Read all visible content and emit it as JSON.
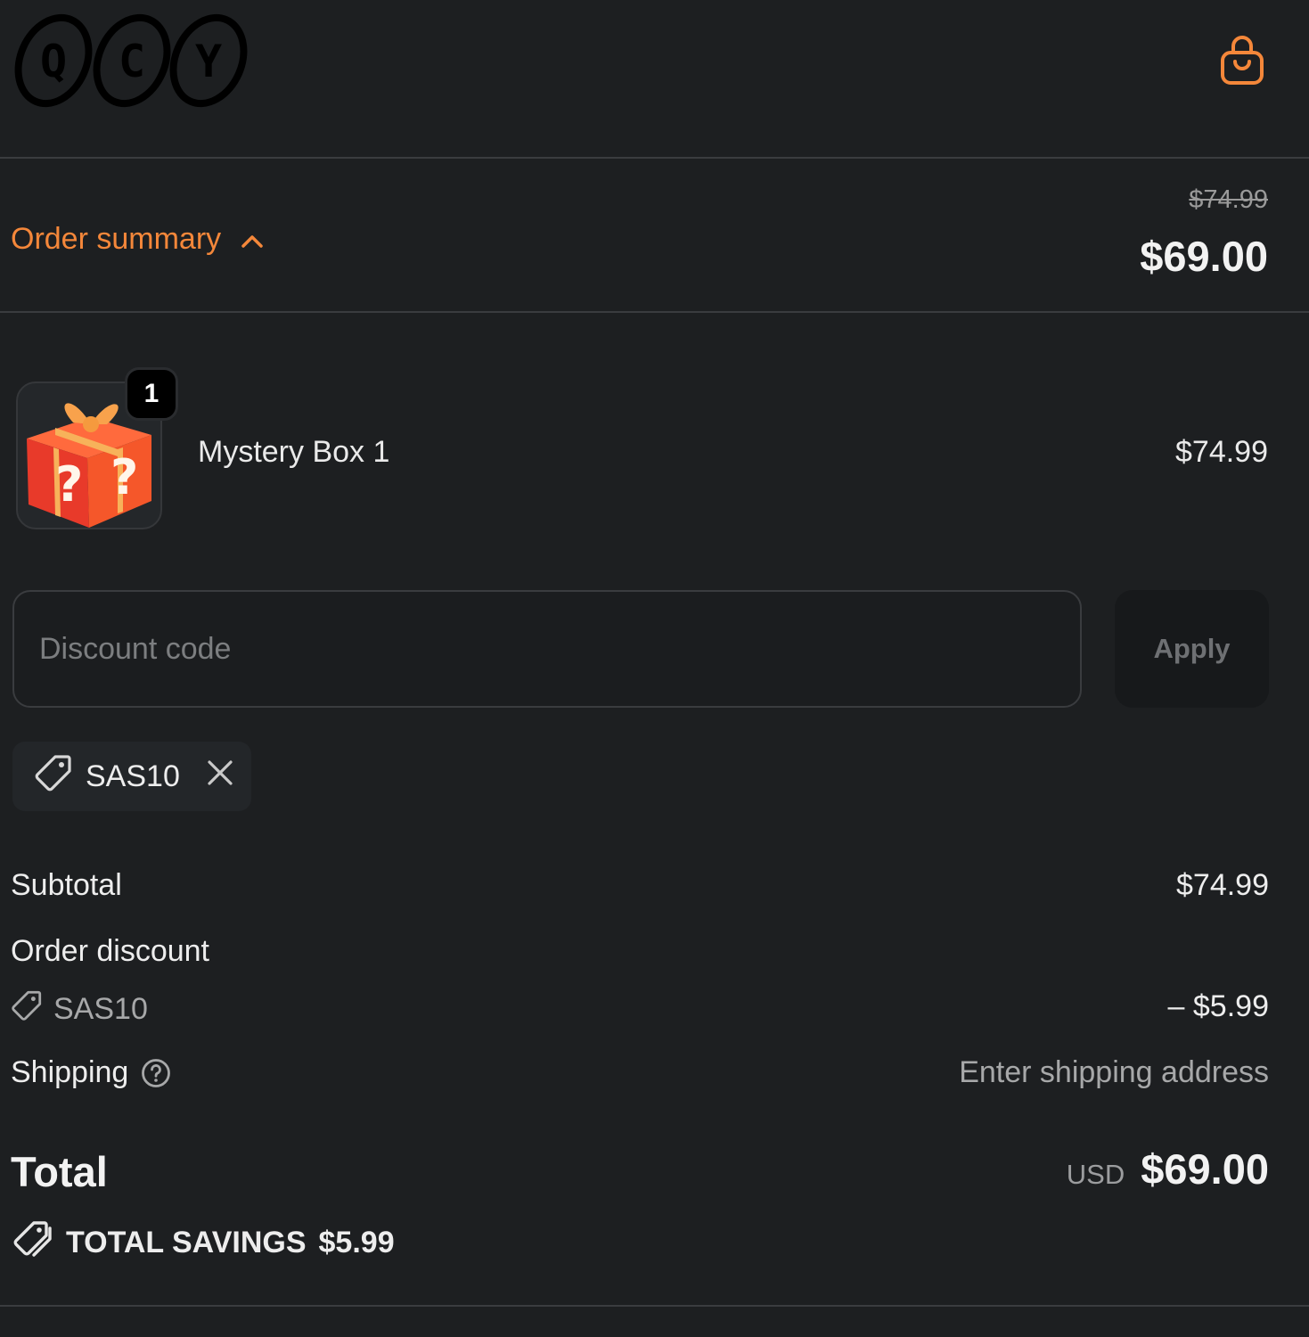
{
  "header": {
    "logo_letters": [
      "Q",
      "C",
      "Y"
    ],
    "cart_icon": "shopping-bag-icon"
  },
  "summary": {
    "toggle_label": "Order summary",
    "toggle_icon": "chevron-up-icon",
    "original_price": "$74.99",
    "discounted_price": "$69.00"
  },
  "product": {
    "name": "Mystery Box 1",
    "price": "$74.99",
    "quantity": "1",
    "image_icon": "mystery-gift-box-image"
  },
  "discount": {
    "placeholder": "Discount code",
    "apply_label": "Apply",
    "applied_code": "SAS10"
  },
  "totals": {
    "subtotal_label": "Subtotal",
    "subtotal_value": "$74.99",
    "order_discount_label": "Order discount",
    "discount_code": "SAS10",
    "discount_value": "– $5.99",
    "shipping_label": "Shipping",
    "shipping_value": "Enter shipping address",
    "total_label": "Total",
    "currency": "USD",
    "total_value": "$69.00",
    "savings_label": "TOTAL SAVINGS",
    "savings_value": "$5.99"
  },
  "colors": {
    "accent": "#f4873a",
    "background": "#1d1f21"
  }
}
